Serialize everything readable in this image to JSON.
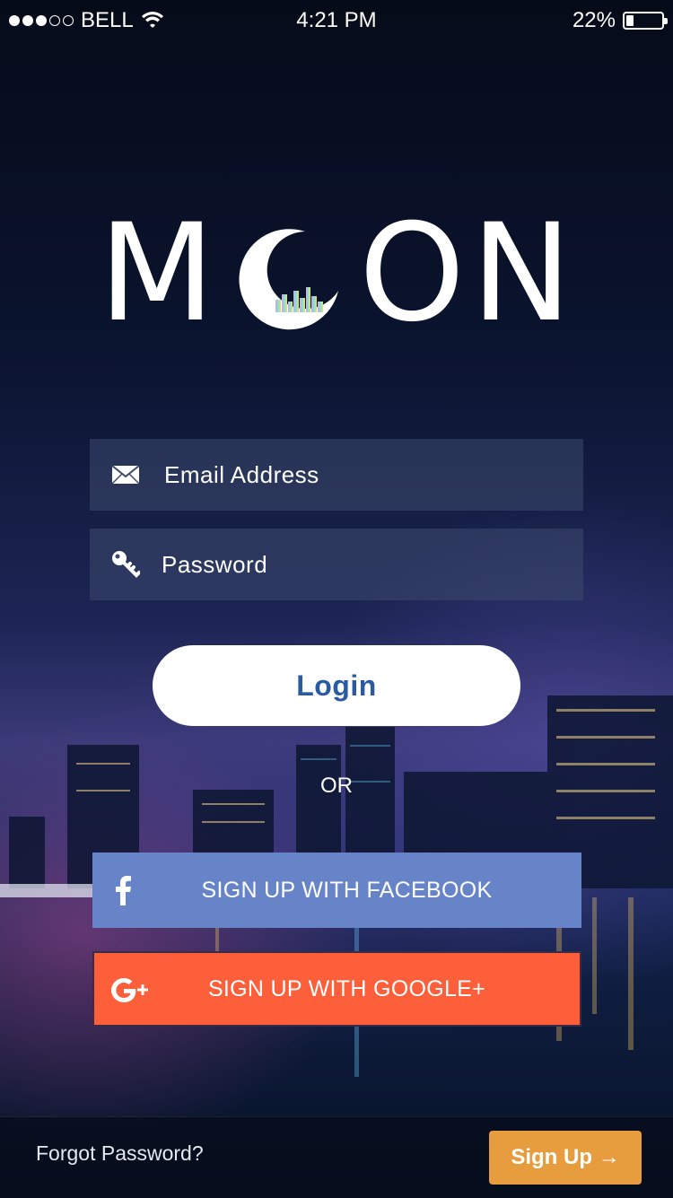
{
  "status_bar": {
    "carrier": "BELL",
    "time": "4:21 PM",
    "battery_percent": "22%",
    "battery_level": 0.22
  },
  "logo": {
    "letters": [
      "M",
      "O",
      "N"
    ],
    "moon_icon": "crescent-moon-city-icon"
  },
  "form": {
    "email_placeholder": "Email Address",
    "email_icon": "envelope-icon",
    "password_placeholder": "Password",
    "password_icon": "key-icon",
    "login_label": "Login",
    "or_label": "OR"
  },
  "social": {
    "facebook_label": "SIGN UP WITH FACEBOOK",
    "facebook_icon": "facebook-icon",
    "google_label": "SIGN UP WITH GOOGLE+",
    "google_icon": "google-plus-icon"
  },
  "footer": {
    "forgot_label": "Forgot Password?",
    "signup_label": "Sign Up →"
  },
  "colors": {
    "login_text": "#2a5aa2",
    "facebook": "#6784c9",
    "google": "#fd5f3a",
    "signup": "#e79d3e"
  }
}
